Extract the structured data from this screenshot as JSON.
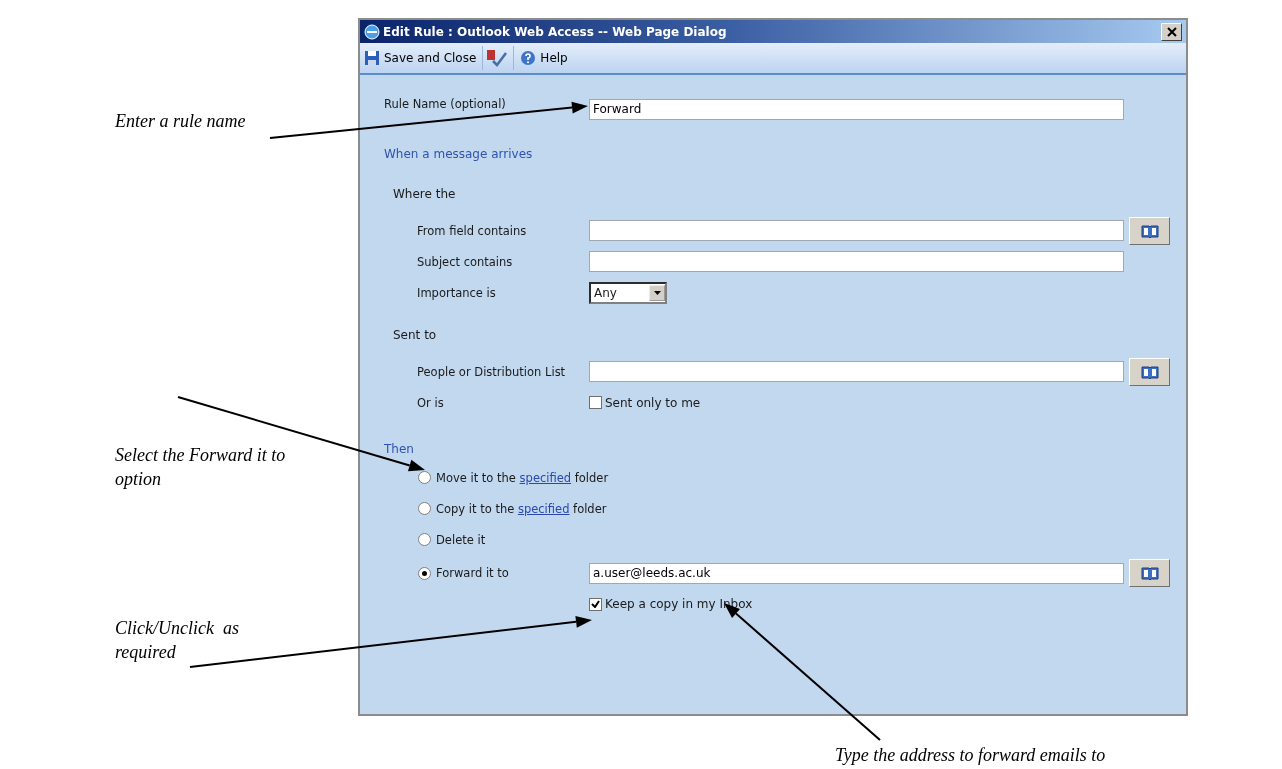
{
  "window": {
    "title": "Edit Rule : Outlook Web Access -- Web Page Dialog"
  },
  "toolbar": [
    {
      "kind": "save",
      "label": "Save and Close"
    },
    {
      "kind": "spell"
    },
    {
      "kind": "help",
      "label": "Help"
    }
  ],
  "rule_name": {
    "label": "Rule Name  (optional)",
    "value": "Forward"
  },
  "conditions": {
    "heading": "When a message arrives",
    "groups": [
      {
        "title": "Where the",
        "rows": [
          {
            "kind": "text",
            "label": "From field contains",
            "address_book": true
          },
          {
            "kind": "text",
            "label": "Subject contains",
            "address_book": false
          },
          {
            "kind": "select",
            "label": "Importance is",
            "value": "Any"
          }
        ]
      },
      {
        "title": "Sent to",
        "rows": [
          {
            "kind": "text",
            "label": "People or Distribution List",
            "address_book": true
          },
          {
            "kind": "checkbox",
            "label": "Or is",
            "option": "Sent only to me",
            "checked": false
          }
        ]
      }
    ]
  },
  "actions": {
    "heading": "Then",
    "options": [
      {
        "kind": "link",
        "before": "Move it to the",
        "link": "specified",
        "after": "folder",
        "selected": false
      },
      {
        "kind": "link",
        "before": "Copy it to the",
        "link": "specified",
        "after": "folder",
        "selected": false
      },
      {
        "kind": "plain",
        "label": "Delete it",
        "selected": false
      },
      {
        "kind": "forward",
        "label": "Forward it to",
        "selected": true,
        "value": "a.user@leeds.ac.uk",
        "address_book": true
      }
    ],
    "keep_copy": {
      "label": "Keep a copy in my Inbox",
      "checked": true
    }
  },
  "annotations": [
    {
      "text": "Enter a rule name"
    },
    {
      "text": "Select the Forward it to option"
    },
    {
      "text": "Click/Unclick  as required"
    },
    {
      "text": "Type the address to forward emails to"
    }
  ]
}
